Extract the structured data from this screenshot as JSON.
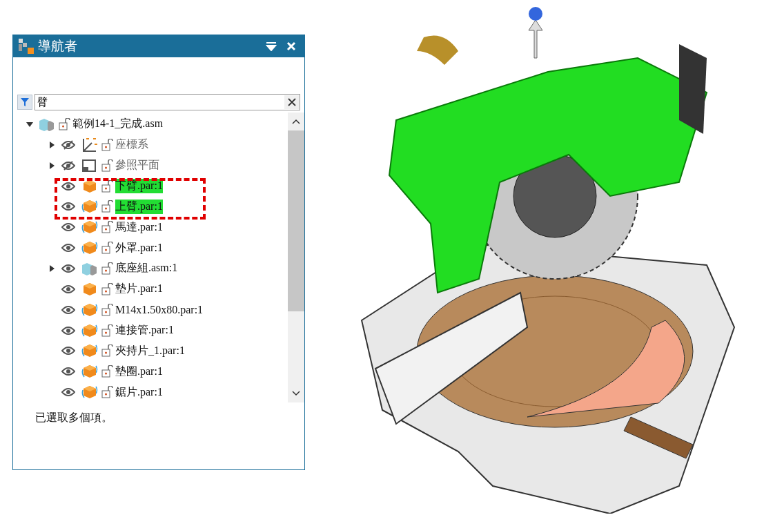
{
  "navigator": {
    "title": "導航者",
    "search": {
      "value": "臂"
    },
    "tree": [
      {
        "label": "範例14-1_完成.asm",
        "kind": "assembly",
        "expanded": true,
        "children": [
          {
            "label": "座標系",
            "kind": "coordinate-system",
            "visible": false,
            "expanded": false,
            "highlighted": false,
            "linked": false
          },
          {
            "label": "參照平面",
            "kind": "reference-plane",
            "visible": false,
            "expanded": false,
            "highlighted": false,
            "linked": false
          },
          {
            "label": "下臂.par:1",
            "kind": "part",
            "visible": true,
            "highlighted": true,
            "linked": false
          },
          {
            "label": "上臂.par:1",
            "kind": "part",
            "visible": true,
            "highlighted": true,
            "linked": true
          },
          {
            "label": "馬達.par:1",
            "kind": "part",
            "visible": true,
            "highlighted": false,
            "linked": true
          },
          {
            "label": "外罩.par:1",
            "kind": "part",
            "visible": true,
            "highlighted": false,
            "linked": true
          },
          {
            "label": "底座組.asm:1",
            "kind": "assembly",
            "visible": true,
            "expanded": false,
            "highlighted": false,
            "linked": false
          },
          {
            "label": "墊片.par:1",
            "kind": "part",
            "visible": true,
            "highlighted": false,
            "linked": false
          },
          {
            "label": "M14x1.50x80.par:1",
            "kind": "part",
            "visible": true,
            "highlighted": false,
            "linked": true
          },
          {
            "label": "連接管.par:1",
            "kind": "part",
            "visible": true,
            "highlighted": false,
            "linked": true
          },
          {
            "label": "夾持片_1.par:1",
            "kind": "part",
            "visible": true,
            "highlighted": false,
            "linked": true
          },
          {
            "label": "墊圈.par:1",
            "kind": "part",
            "visible": true,
            "highlighted": false,
            "linked": true
          },
          {
            "label": "鋸片.par:1",
            "kind": "part",
            "visible": true,
            "highlighted": false,
            "linked": true
          }
        ]
      }
    ],
    "status": "已選取多個項。"
  }
}
